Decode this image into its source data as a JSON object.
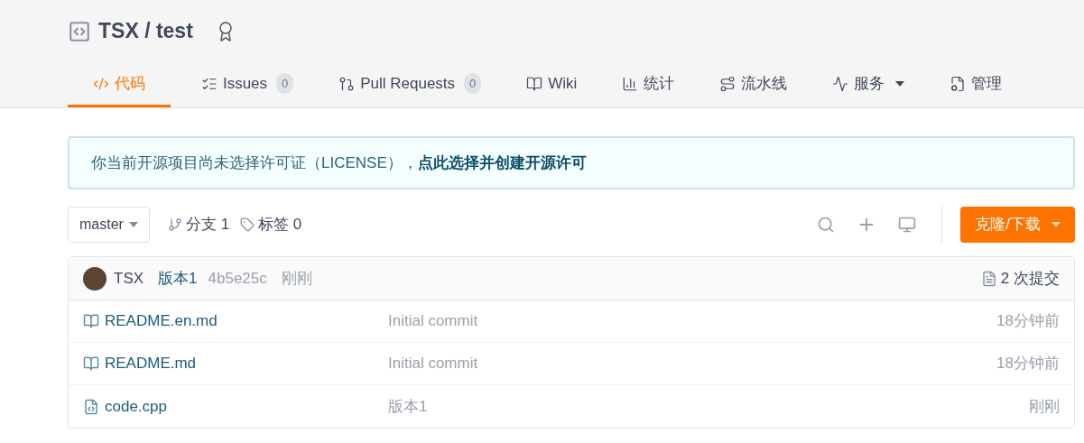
{
  "repo": {
    "owner": "TSX",
    "separator": "/",
    "name": "test"
  },
  "tabs": [
    {
      "label": "代码",
      "selected": true
    },
    {
      "label": "Issues",
      "count": "0",
      "selected": false
    },
    {
      "label": "Pull Requests",
      "count": "0",
      "selected": false
    },
    {
      "label": "Wiki",
      "selected": false
    },
    {
      "label": "统计",
      "selected": false
    },
    {
      "label": "流水线",
      "selected": false
    },
    {
      "label": "服务",
      "dropdown": true,
      "selected": false
    },
    {
      "label": "管理",
      "selected": false
    }
  ],
  "notice": {
    "text": "你当前开源项目尚未选择许可证（LICENSE），",
    "link": "点此选择并创建开源许可"
  },
  "toolbar": {
    "branch": "master",
    "branches": "分支 1",
    "tags": "标签 0",
    "clone_button": "克隆/下载"
  },
  "last_commit": {
    "author": "TSX",
    "message": "版本1",
    "hash": "4b5e25c",
    "time": "刚刚",
    "commit_count": "2 次提交"
  },
  "files": [
    {
      "kind": "doc",
      "name": "README.en.md",
      "message": "Initial commit",
      "time": "18分钟前"
    },
    {
      "kind": "doc",
      "name": "README.md",
      "message": "Initial commit",
      "time": "18分钟前"
    },
    {
      "kind": "code",
      "name": "code.cpp",
      "message": "版本1",
      "time": "刚刚"
    }
  ]
}
